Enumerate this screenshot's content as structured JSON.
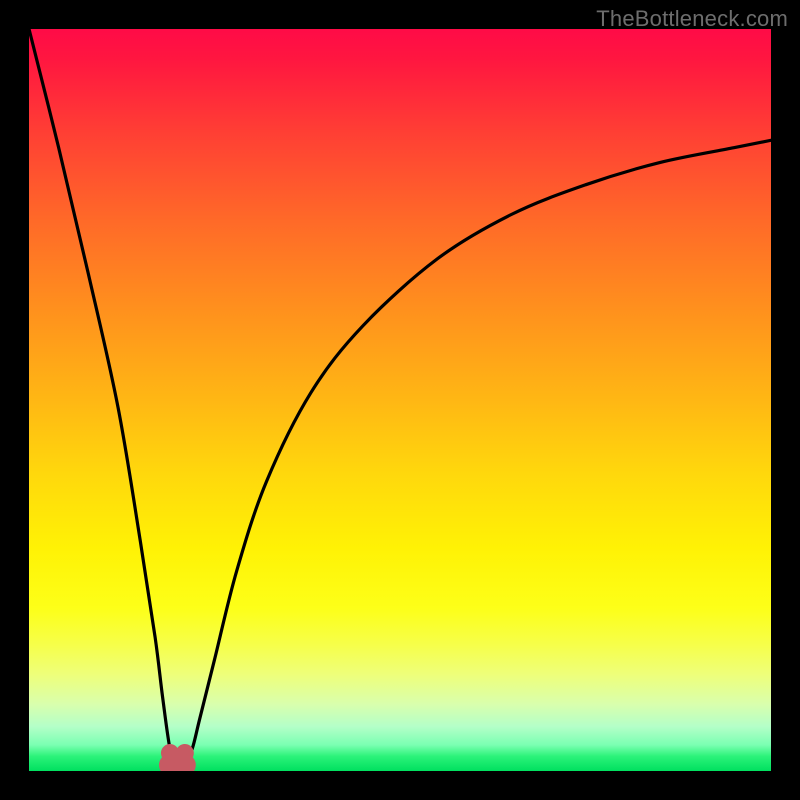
{
  "watermark": {
    "text": "TheBottleneck.com"
  },
  "colors": {
    "frame": "#000000",
    "curve": "#000000",
    "marker": "#c75a63"
  },
  "chart_data": {
    "type": "line",
    "title": "",
    "xlabel": "",
    "ylabel": "",
    "xlim": [
      0,
      100
    ],
    "ylim": [
      0,
      100
    ],
    "grid": false,
    "legend": false,
    "notes": "Bottleneck-style curve. y≈100 is top (red), y≈0 is bottom (green). Minimum near x≈20 at y≈0; y→100 as x→0 and y rises toward ~85 as x→100.",
    "series": [
      {
        "name": "bottleneck-curve",
        "x": [
          0,
          4,
          8,
          12,
          15,
          17,
          18,
          19,
          20,
          21,
          22,
          23,
          25,
          28,
          32,
          38,
          45,
          55,
          65,
          75,
          85,
          95,
          100
        ],
        "y": [
          100,
          84,
          67,
          49,
          31,
          18,
          10,
          3,
          0,
          1,
          3,
          7,
          15,
          27,
          39,
          51,
          60,
          69,
          75,
          79,
          82,
          84,
          85
        ]
      }
    ],
    "markers": [
      {
        "name": "min-foot-left",
        "x": 19,
        "y": 0
      },
      {
        "name": "min-foot-right",
        "x": 21,
        "y": 0
      }
    ]
  }
}
